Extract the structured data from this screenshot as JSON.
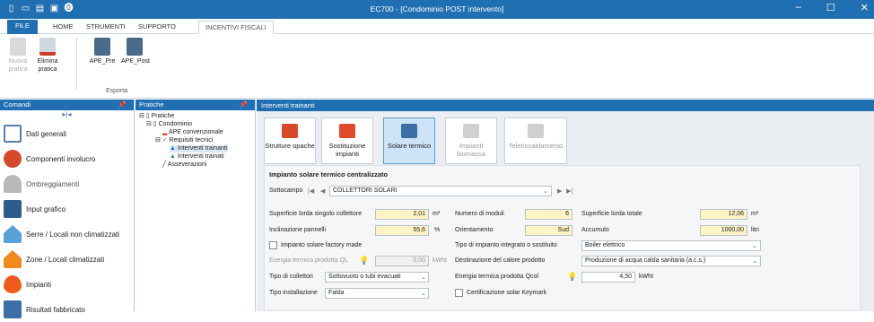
{
  "window": {
    "title": "EC700 - [Condominio POST intervento]",
    "controls": [
      "–",
      "☐",
      "✕"
    ]
  },
  "quick_access": [
    "▯",
    "▭",
    "▤",
    "▣",
    "⓿"
  ],
  "ribbon_tabs": [
    "FILE",
    "HOME",
    "STRUMENTI",
    "SUPPORTO",
    "INCENTIVI FISCALI"
  ],
  "ribbon": {
    "buttons": [
      "Nuova pratica",
      "Elimina pratica",
      "APE_Pre",
      "APE_Post"
    ],
    "group": "Esporta"
  },
  "comandi": {
    "title": "Comandi",
    "items": [
      "Dati generali",
      "Componenti involucro",
      "Ombreggiamenti",
      "Input grafico",
      "Serre / Locali non climatizzati",
      "Zone / Locali climatizzati",
      "Impianti",
      "Risultati fabbricato"
    ]
  },
  "pratiche": {
    "title": "Pratiche",
    "tree": [
      "Pratiche",
      "Condominio",
      "APE convenzionale",
      "Requisiti tecnici",
      "Interventi trainanti",
      "Interventi trainati",
      "Asseverazioni"
    ]
  },
  "main": {
    "title": "Interventi trainanti",
    "buttons": [
      "Strutture opache",
      "Sostituzione impianti",
      "Solare termico",
      "Impianti biomassa",
      "Teleriscaldamento"
    ],
    "section_title": "Impianto solare termico centralizzato",
    "sottocampo_label": "Sottocampo",
    "sottocampo_value": "COLLETTORI SOLARI",
    "nav": [
      "|◀",
      "◀",
      "▶",
      "▶|"
    ],
    "form": {
      "sup_lorda_coll_label": "Superficie lorda singolo collettore",
      "sup_lorda_coll_value": "2,01",
      "sup_lorda_coll_unit": "m²",
      "num_moduli_label": "Numero di moduli",
      "num_moduli_value": "6",
      "sup_lorda_tot_label": "Superficie lorda totale",
      "sup_lorda_tot_value": "12,06",
      "sup_lorda_tot_unit": "m²",
      "inclinazione_label": "Inclinazione pannelli",
      "inclinazione_value": "55,6",
      "inclinazione_unit": "%",
      "orientamento_label": "Orientamento",
      "orientamento_value": "Sud",
      "accumulo_label": "Accumulo",
      "accumulo_value": "1000,00",
      "accumulo_unit": "litri",
      "factory_label": "Impianto solare factory made",
      "tipo_integrato_label": "Tipo di impianto integrato o sostituito",
      "tipo_integrato_value": "Boiler elettrico",
      "energia_ql_label": "Energia termica prodotta QL",
      "energia_ql_value": "0,00",
      "energia_ql_unit": "kWht",
      "destinazione_label": "Destinazione del calore prodotto",
      "destinazione_value": "Produzione di acqua calda sanitaria (a.c.s.)",
      "tipo_coll_label": "Tipo di collettori",
      "tipo_coll_value": "Sottovuoto o tubi evacuati",
      "energia_qcol_label": "Energia termica prodotta  Qcol",
      "energia_qcol_value": "4,50",
      "energia_qcol_unit": "kWht",
      "tipo_inst_label": "Tipo installazione",
      "tipo_inst_value": "Falda",
      "keymark_label": "Certificazione solar Keymark"
    }
  },
  "colors": {
    "accent": "#1f6fb2",
    "input_yellow": "#fdf3c6",
    "selected": "#cde3f7"
  }
}
